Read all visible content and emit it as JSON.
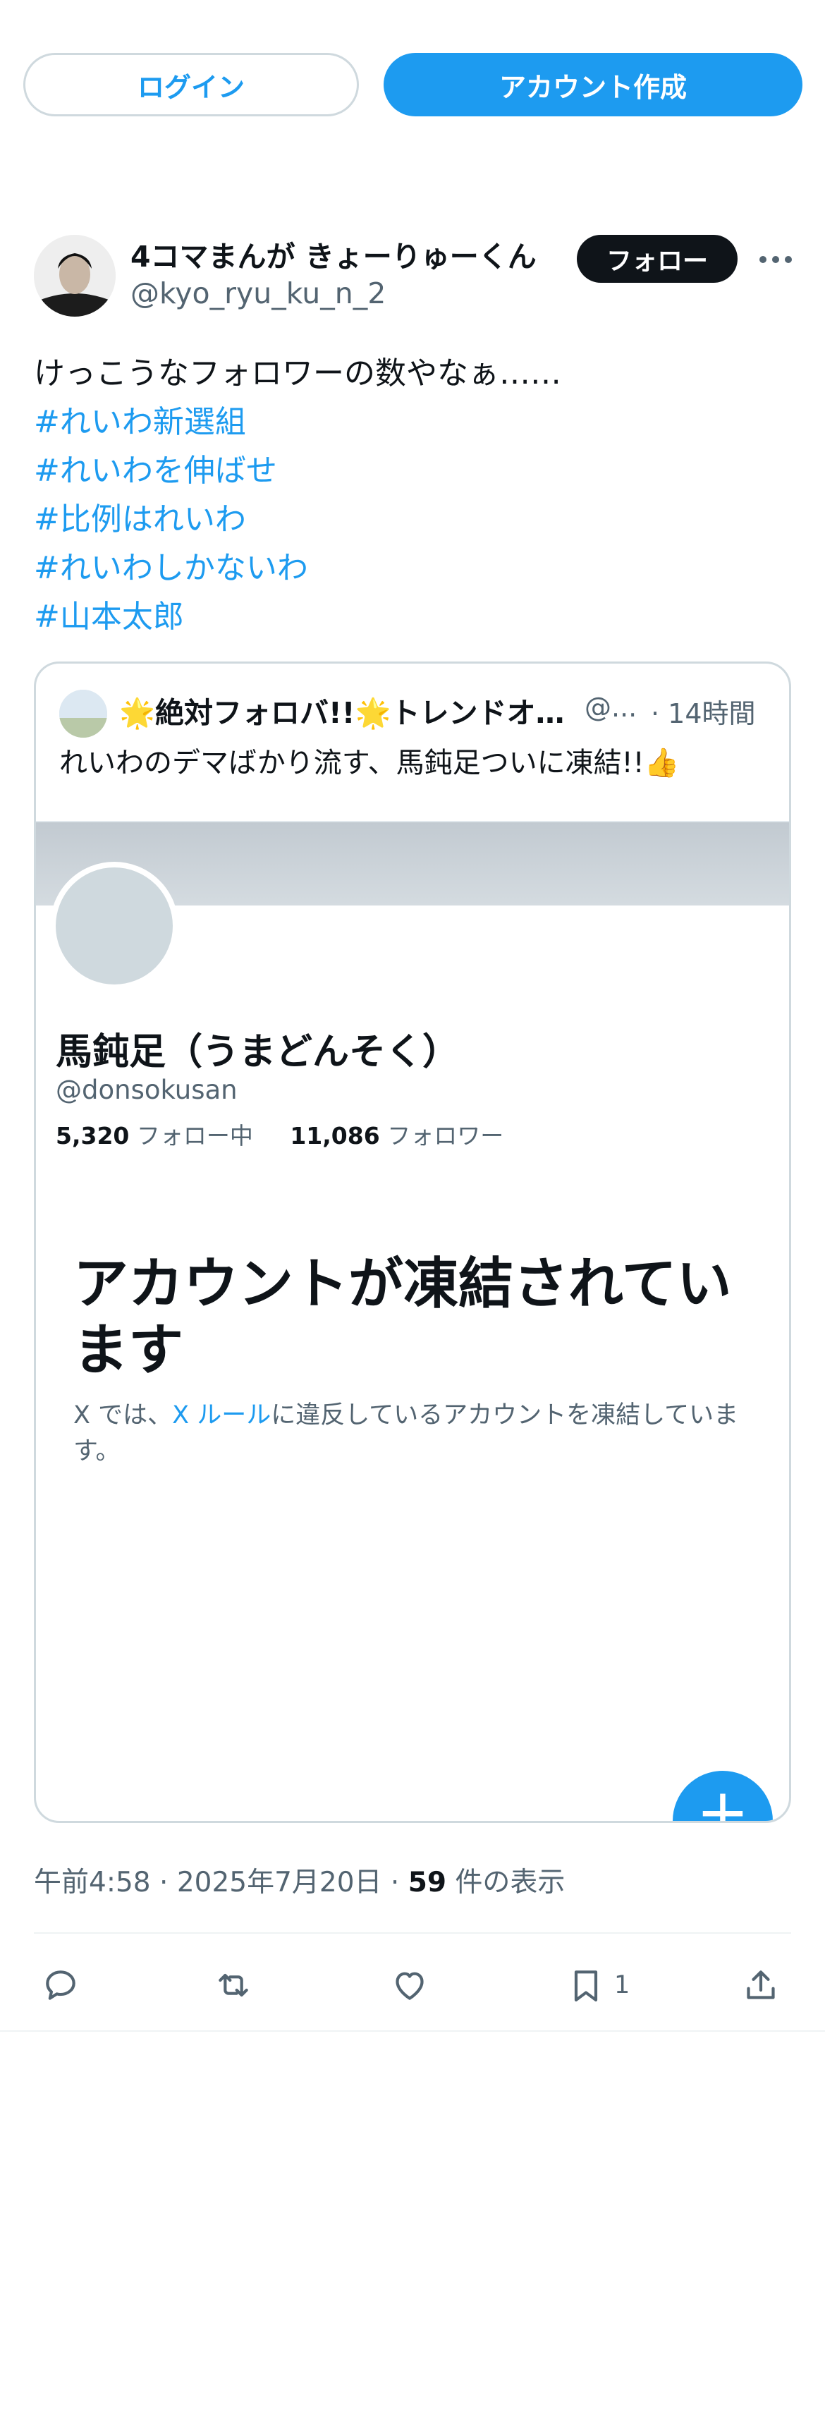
{
  "topbar": {
    "login_label": "ログイン",
    "signup_label": "アカウント作成"
  },
  "tweet": {
    "author_name": "4コマまんが きょーりゅーくん",
    "author_handle": "@kyo_ryu_ku_n_2",
    "follow_label": "フォロー",
    "text": "けっこうなフォロワーの数やなぁ……",
    "hashtags": [
      "#れいわ新選組",
      "#れいわを伸ばせ",
      "#比例はれいわ",
      "#れいわしかないわ",
      "#山本太郎"
    ]
  },
  "quote": {
    "author_name": "🌟絶対フォロバ!!🌟トレンドオ…",
    "author_handle": "@...",
    "time": "· 14時間",
    "text": "れいわのデマばかり流す、馬鈍足ついに凍結!!👍",
    "screenshot": {
      "profile_name": "馬鈍足（うまどんそく）",
      "profile_handle": "@donsokusan",
      "following_count": "5,320",
      "following_label": "フォロー中",
      "followers_count": "11,086",
      "followers_label": "フォロワー",
      "suspended_title": "アカウントが凍結されています",
      "suspended_desc_pre": "X では、",
      "suspended_desc_link": "X ルール",
      "suspended_desc_post": "に違反しているアカウントを凍結しています。",
      "fab_symbol": "+"
    }
  },
  "meta": {
    "time": "午前4:58",
    "sep": "·",
    "date": "2025年7月20日",
    "views_count": "59",
    "views_label": "件の表示"
  },
  "actions": {
    "reply_icon": "reply-icon",
    "retweet_icon": "retweet-icon",
    "like_icon": "heart-icon",
    "bookmark_icon": "bookmark-icon",
    "bookmark_count": "1",
    "share_icon": "share-icon"
  },
  "colors": {
    "accent": "#1d9bf0",
    "text": "#0f1419",
    "muted": "#536471",
    "border": "#cfd9de"
  }
}
